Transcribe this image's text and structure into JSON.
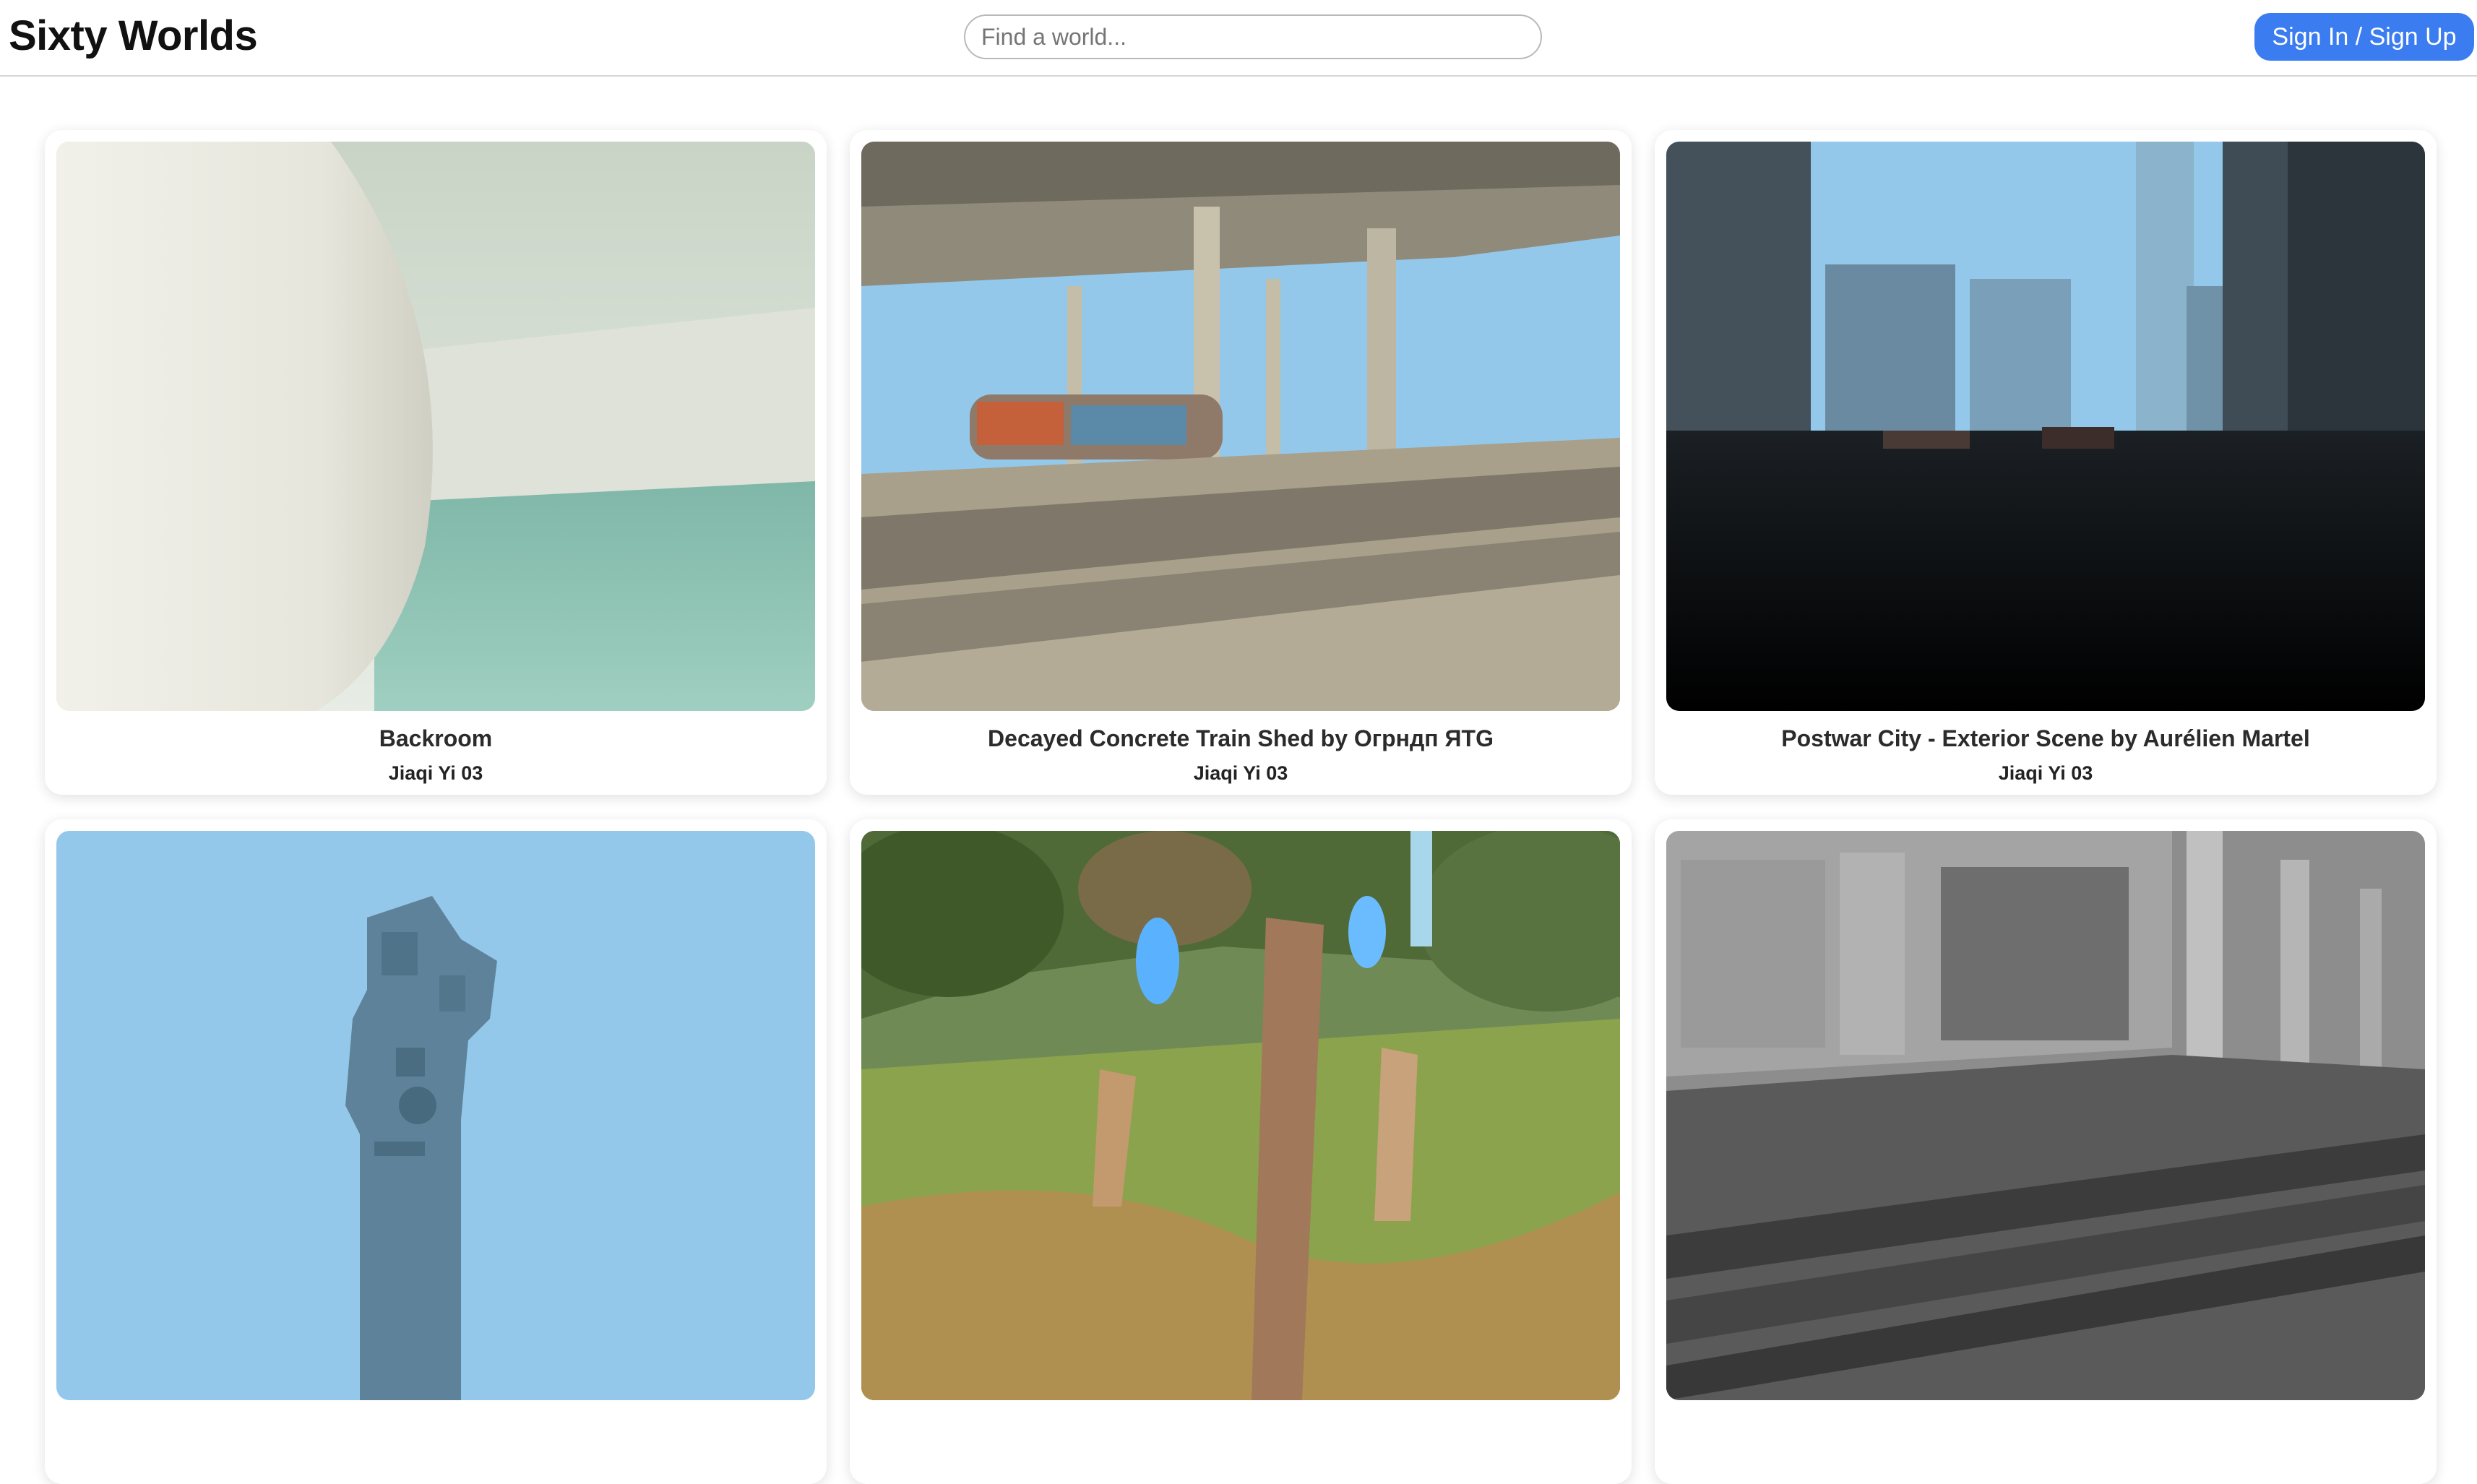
{
  "header": {
    "brand": "Sixty Worlds",
    "search_placeholder": "Find a world...",
    "signin_label": "Sign In / Sign Up"
  },
  "colors": {
    "accent": "#3b7cf0",
    "sky": "#94c8ea"
  },
  "worlds": [
    {
      "title": "Backroom",
      "author": "Jiaqi Yi 03",
      "thumb": "white curved room with teal water floor"
    },
    {
      "title": "Decayed Concrete Train Shed by Огрндп ЯТG",
      "author": "Jiaqi Yi 03",
      "thumb": "concrete train shed with graffiti wagon"
    },
    {
      "title": "Postwar City - Exterior Scene by Aurélien Martel",
      "author": "Jiaqi Yi 03",
      "thumb": "dark ruined city with tall buildings"
    },
    {
      "title": "",
      "author": "",
      "thumb": "grey stone tower against blue sky"
    },
    {
      "title": "",
      "author": "",
      "thumb": "stylized forest with blue flames"
    },
    {
      "title": "",
      "author": "",
      "thumb": "grey untextured train and pipes"
    }
  ]
}
